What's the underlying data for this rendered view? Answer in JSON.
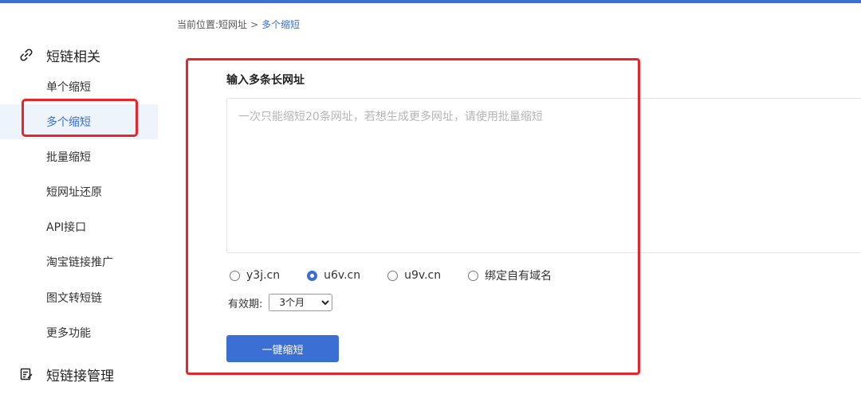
{
  "breadcrumb": {
    "prefix": "当前位置:",
    "parent": "短网址",
    "separator": ">",
    "current": "多个缩短"
  },
  "sidebar": {
    "group1": {
      "label": "短链相关",
      "icon": "link-icon"
    },
    "items": [
      {
        "label": "单个缩短"
      },
      {
        "label": "多个缩短",
        "active": true
      },
      {
        "label": "批量缩短"
      },
      {
        "label": "短网址还原"
      },
      {
        "label": "API接口"
      },
      {
        "label": "淘宝链接推广"
      },
      {
        "label": "图文转短链"
      },
      {
        "label": "更多功能"
      }
    ],
    "group2": {
      "label": "短链接管理",
      "icon": "edit-list-icon"
    }
  },
  "main": {
    "title": "输入多条长网址",
    "input": {
      "value": "",
      "placeholder": "一次只能缩短20条网址，若想生成更多网址，请使用批量缩短"
    },
    "domains": [
      {
        "label": "y3j.cn",
        "checked": false
      },
      {
        "label": "u6v.cn",
        "checked": true
      },
      {
        "label": "u9v.cn",
        "checked": false
      },
      {
        "label": "绑定自有域名",
        "checked": false
      }
    ],
    "validity": {
      "label": "有效期:",
      "selected": "3个月"
    },
    "submit_label": "一键缩短"
  },
  "colors": {
    "accent": "#3b6fd4",
    "highlight": "#e8262a",
    "active_bg": "#eef4fc"
  }
}
